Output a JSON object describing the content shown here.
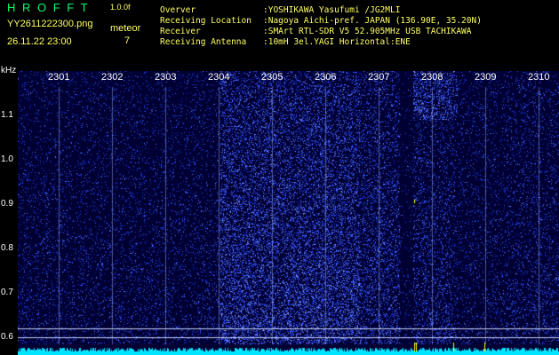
{
  "app": {
    "title": "H R O F F T",
    "version": "1.0.0f",
    "filename": "YY2611222300.png",
    "datetime": "26.11.22 23:00",
    "meteor_label": "meteor",
    "meteor_count": "7"
  },
  "info": [
    {
      "key": "Overver",
      "value": ":YOSHIKAWA Yasufumi /JG2MLI"
    },
    {
      "key": "Receiving Location",
      "value": ":Nagoya Aichi-pref. JAPAN (136.90E, 35.20N)"
    },
    {
      "key": "Receiver",
      "value": ":SMArt RTL-SDR V5 52.905MHz USB TACHIKAWA"
    },
    {
      "key": "Receiving Antenna",
      "value": ":10mH 3el.YAGI Horizontal:ENE"
    }
  ],
  "axis": {
    "y_unit": "kHz",
    "y_ticks": [
      "1.1",
      "1.0",
      "0.9",
      "0.8",
      "0.7",
      "0.6"
    ],
    "x_ticks": [
      "2301",
      "2302",
      "2303",
      "2304",
      "2305",
      "2306",
      "2307",
      "2308",
      "2309",
      "2310"
    ]
  },
  "colors": {
    "title": "#00ff66",
    "label": "#ffff66",
    "info": "#ffff66",
    "text": "#ffffff",
    "background": "#000033",
    "noise": "#2040ff",
    "baseline": "#00e5ff",
    "meteor": "#ffff00"
  }
}
